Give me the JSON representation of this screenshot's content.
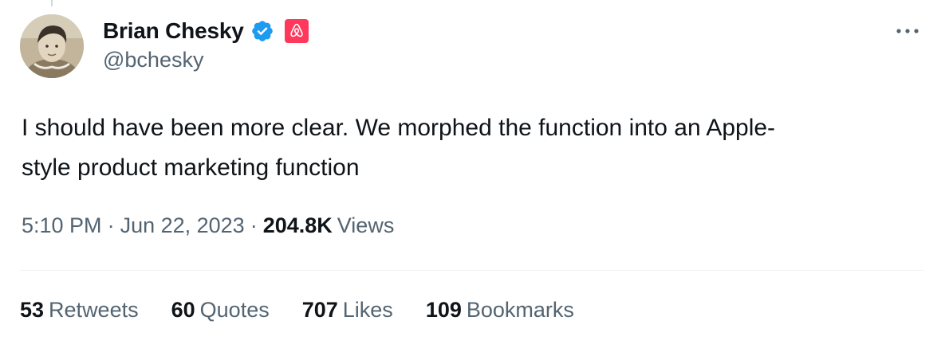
{
  "author": {
    "display_name": "Brian Chesky",
    "handle": "@bchesky",
    "verified_icon": "verified-badge-icon",
    "affiliation_icon": "airbnb-logo-icon",
    "verified_color": "#1d9bf0",
    "affiliation_color": "#ff385c"
  },
  "tweet": {
    "text_lines": [
      "I should have been more clear. We morphed the function into an Apple-",
      "style product marketing function"
    ],
    "time": "5:10 PM",
    "separator": "·",
    "date": "Jun 22, 2023",
    "views_count": "204.8K",
    "views_label": "Views"
  },
  "stats": [
    {
      "count": "53",
      "label": "Retweets"
    },
    {
      "count": "60",
      "label": "Quotes"
    },
    {
      "count": "707",
      "label": "Likes"
    },
    {
      "count": "109",
      "label": "Bookmarks"
    }
  ],
  "colors": {
    "text_primary": "#0f1419",
    "text_secondary": "#536471",
    "divider": "#eff3f4"
  }
}
